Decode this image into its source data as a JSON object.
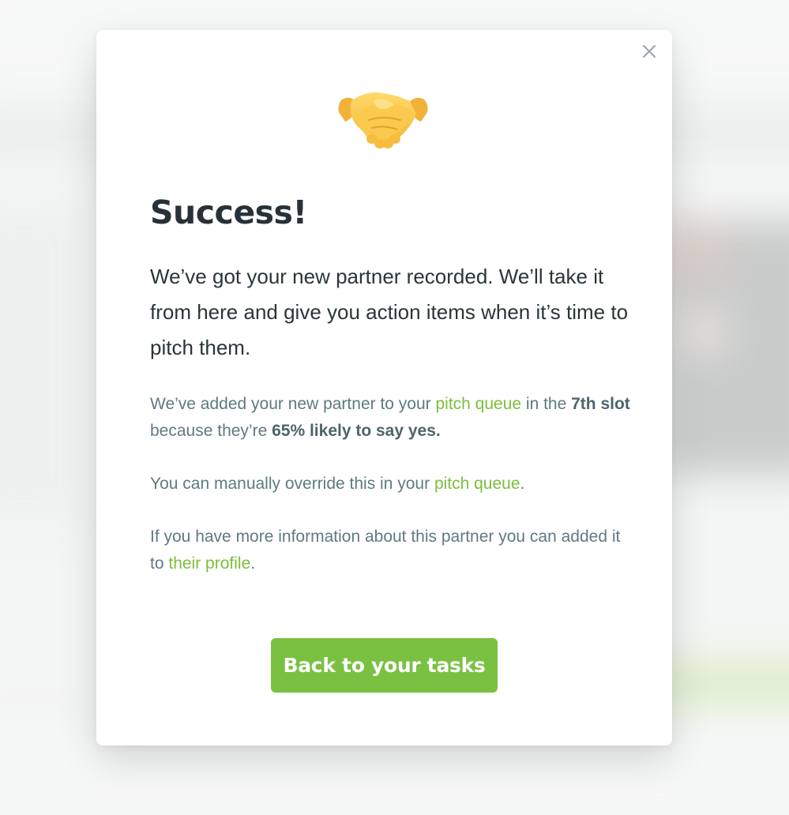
{
  "modal": {
    "close_label": "×",
    "icon": "handshake-icon",
    "title": "Success!",
    "lead": "We’ve got your new partner recorded. We’ll take it from here and give you action items when it’s time to pitch them.",
    "p1": {
      "t1": "We’ve added your new partner to your ",
      "link1": "pitch queue",
      "t2": " in the ",
      "bold1": "7th slot",
      "t3": " because they’re ",
      "bold2": "65% likely to say yes."
    },
    "p2": {
      "t1": "You can manually override this in your ",
      "link1": "pitch queue",
      "t2": "."
    },
    "p3": {
      "t1": "If you have more information about this partner you can added it to ",
      "link1": "their profile",
      "t2": "."
    },
    "cta_label": "Back to your tasks"
  },
  "colors": {
    "accent": "#7ac142",
    "link": "#7bbf3a",
    "heading": "#273238",
    "body_text": "#5f7a80"
  }
}
